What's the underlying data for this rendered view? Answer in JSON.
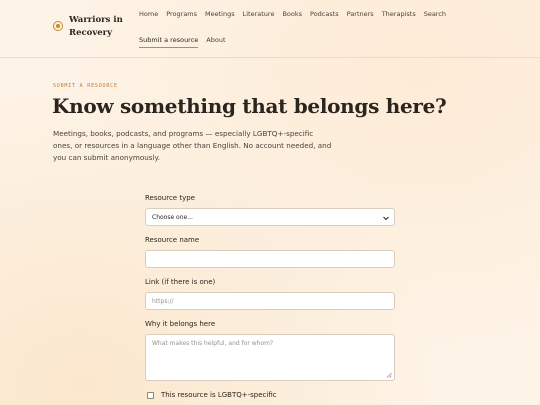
{
  "brand": {
    "name_line1": "Warriors in",
    "name_line2": "Recovery",
    "icon": "brand-circle-icon",
    "accent": "#c98a2a"
  },
  "nav": {
    "row1": [
      "Home",
      "Programs",
      "Meetings",
      "Literature",
      "Books",
      "Podcasts",
      "Partners",
      "Therapists",
      "Search"
    ],
    "row2": [
      "Submit a resource",
      "About"
    ],
    "active": "Submit a resource"
  },
  "hero": {
    "eyebrow": "SUBMIT A RESOURCE",
    "title": "Know something that belongs here?",
    "intro": "Meetings, books, podcasts, and programs — especially LGBTQ+-specific ones, or resources in a language other than English. No account needed, and you can submit anonymously."
  },
  "form": {
    "resource_type": {
      "label": "Resource type",
      "value": "Choose one..."
    },
    "resource_name": {
      "label": "Resource name",
      "placeholder": ""
    },
    "link": {
      "label": "Link (if there is one)",
      "placeholder": "https://"
    },
    "why": {
      "label": "Why it belongs here",
      "placeholder": "What makes this helpful, and for whom?"
    },
    "lgbtq_checkbox": {
      "label": "This resource is LGBTQ+-specific",
      "checked": false
    }
  }
}
